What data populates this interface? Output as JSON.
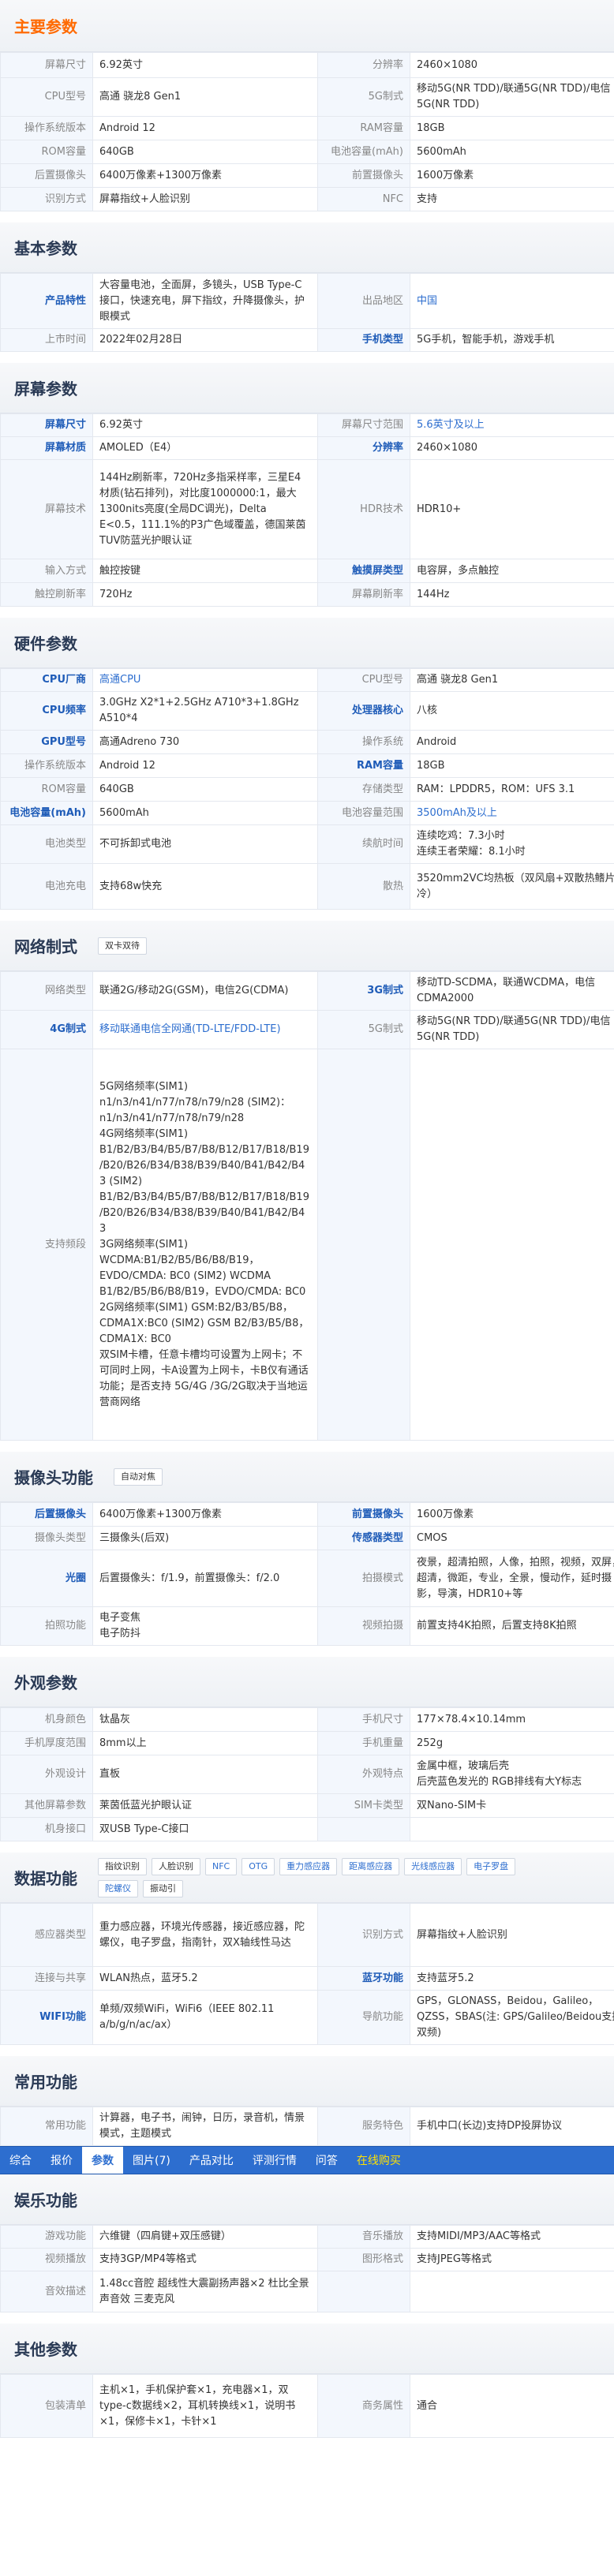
{
  "sections": {
    "main_params": {
      "title": "主要参数",
      "rows": [
        [
          "屏幕尺寸",
          "6.92英寸",
          "分辨率",
          "2460×1080"
        ],
        [
          "CPU型号",
          "高通 骁龙8 Gen1",
          "5G制式",
          "移动5G(NR TDD)/联通5G(NR TDD)/电信 5G(NR TDD)"
        ],
        [
          "操作系统版本",
          "Android 12",
          "RAM容量",
          "18GB"
        ],
        [
          "ROM容量",
          "640GB",
          "电池容量(mAh)",
          "5600mAh"
        ],
        [
          "后置摄像头",
          "6400万像素+1300万像素",
          "前置摄像头",
          "1600万像素"
        ],
        [
          "识别方式",
          "屏幕指纹+人脸识别",
          "NFC",
          "支持"
        ]
      ]
    },
    "basic": {
      "title": "基本参数",
      "rows": [
        [
          "产品特性",
          "大容量电池，全面屏，多镜头，USB Type-C接口，快速充电，屏下指纹，升降摄像头，护眼模式",
          "出品地区",
          "中国"
        ],
        [
          "上市时间",
          "2022年02月28日",
          "手机类型",
          "5G手机，智能手机，游戏手机"
        ]
      ]
    },
    "screen": {
      "title": "屏幕参数",
      "rows": [
        [
          "屏幕尺寸",
          "6.92英寸",
          "屏幕尺寸范围",
          "5.6英寸及以上"
        ],
        [
          "屏幕材质",
          "AMOLED（E4）",
          "分辨率",
          "2460×1080"
        ],
        [
          "屏幕技术",
          "144Hz刷新率，720Hz多指采样率，三星E4材质(钻石排列)，对比度1000000:1，最大1300nits亮度(全局DC调光)，Delta E<0.5，111.1%的P3广色域覆盖，德国莱茵TUV防蓝光护眼认证",
          "HDR技术",
          "HDR10+"
        ],
        [
          "输入方式",
          "触控按键",
          "触摸屏类型",
          "电容屏，多点触控"
        ],
        [
          "触控刷新率",
          "720Hz",
          "屏幕刷新率",
          "144Hz"
        ]
      ]
    },
    "hardware": {
      "title": "硬件参数",
      "rows": [
        [
          "CPU厂商",
          "高通CPU",
          "CPU型号",
          "高通 骁龙8 Gen1"
        ],
        [
          "CPU频率",
          "3.0GHz X2*1+2.5GHz A710*3+1.8GHz A510*4",
          "处理器核心",
          "八核"
        ],
        [
          "GPU型号",
          "高通Adreno 730",
          "操作系统",
          "Android"
        ],
        [
          "操作系统版本",
          "Android 12",
          "RAM容量",
          "18GB"
        ],
        [
          "ROM容量",
          "640GB",
          "存储类型",
          "RAM：LPDDR5，ROM：UFS 3.1"
        ],
        [
          "电池容量(mAh)",
          "5600mAh",
          "电池容量范围",
          "3500mAh及以上"
        ],
        [
          "电池类型",
          "不可拆卸式电池",
          "续航时间",
          "连续吃鸡：7.3小时\n连续王者荣耀：8.1小时"
        ],
        [
          "电池充电",
          "支持68w快充",
          "散热",
          "3520mm2VC均热板（双风扇+双散热鳍片液冷）"
        ]
      ]
    },
    "network": {
      "title": "网络制式",
      "tags": [
        "双卡双待"
      ],
      "rows": [
        [
          "网络类型",
          "联通2G/移动2G(GSM)，电信2G(CDMA)",
          "3G制式",
          "移动TD-SCDMA，联通WCDMA，电信CDMA2000"
        ],
        [
          "4G制式",
          "移动联通电信全网通(TD-LTE/FDD-LTE)",
          "5G制式",
          "移动5G(NR TDD)/联通5G(NR TDD)/电信 5G(NR TDD)"
        ],
        [
          "支持频段",
          "5G网络频率(SIM1) n1/n3/n41/n77/n78/n79/n28 (SIM2)：n1/n3/n41/n77/n78/n79/n28\n4G网络频率(SIM1) B1/B2/B3/B4/B5/B7/B8/B12/B17/B18/B19/B20/B26/B34/B38/B39/B40/B41/B42/B43 (SIM2) B1/B2/B3/B4/B5/B7/B8/B12/B17/B18/B19/B20/B26/B34/B38/B39/B40/B41/B42/B43\n3G网络频率(SIM1) WCDMA:B1/B2/B5/B6/B8/B19，EVDO/CMDA: BC0 (SIM2) WCDMA B1/B2/B5/B6/B8/B19，EVDO/CMDA: BC0\n2G网络频率(SIM1) GSM:B2/B3/B5/B8，CDMA1X:BC0 (SIM2) GSM B2/B3/B5/B8，CDMA1X: BC0\n双SIM卡槽，任意卡槽均可设置为上网卡；不可同时上网，卡A设置为上网卡，卡B仅有通话功能；是否支持 5G/4G /3G/2G取决于当地运营商网络",
          "",
          ""
        ]
      ]
    },
    "camera": {
      "title": "摄像头功能",
      "tags": [
        "自动对焦"
      ],
      "rows": [
        [
          "后置摄像头",
          "6400万像素+1300万像素",
          "前置摄像头",
          "1600万像素"
        ],
        [
          "摄像头类型",
          "三摄像头(后双)",
          "传感器类型",
          "CMOS"
        ],
        [
          "光圈",
          "后置摄像头：f/1.9，前置摄像头：f/2.0",
          "拍摄模式",
          "夜景，超清拍照，人像，拍照，视频，双屏，超清，微距，专业，全景，慢动作，延时摄影，导演，HDR10+等"
        ],
        [
          "拍照功能",
          "电子变焦\n电子防抖",
          "视频拍摄",
          "前置支持4K拍照，后置支持8K拍照"
        ]
      ]
    },
    "appearance": {
      "title": "外观参数",
      "rows": [
        [
          "机身颜色",
          "钛晶灰",
          "手机尺寸",
          "177×78.4×10.14mm"
        ],
        [
          "手机厚度范围",
          "8mm以上",
          "手机重量",
          "252g"
        ],
        [
          "外观设计",
          "直板",
          "外观特点",
          "金属中框，玻璃后壳\n后壳蓝色发光的 RGB排线有大Y标志"
        ],
        [
          "其他屏幕参数",
          "莱茵低蓝光护眼认证",
          "SIM卡类型",
          "双Nano-SIM卡"
        ],
        [
          "机身接口",
          "双USB Type-C接口",
          "",
          ""
        ]
      ]
    },
    "data": {
      "title": "数据功能",
      "tags": [
        "指纹识别",
        "人脸识别",
        "NFC",
        "OTG",
        "重力感应器",
        "距离感应器",
        "光线感应器",
        "电子罗盘",
        "陀螺仪",
        "振动引"
      ],
      "rows": [
        [
          "感应器类型",
          "重力感应器，环境光传感器，接近感应器，陀螺仪，电子罗盘，指南针，双X轴线性马达",
          "识别方式",
          "屏幕指纹+人脸识别"
        ],
        [
          "连接与共享",
          "WLAN热点，蓝牙5.2",
          "蓝牙功能",
          "支持蓝牙5.2"
        ],
        [
          "WIFI功能",
          "单频/双频WiFi，WiFi6（IEEE 802.11 a/b/g/n/ac/ax）",
          "导航功能",
          "GPS，GLONASS，Beidou，Galileo，QZSS，SBAS(注: GPS/Galileo/Beidou支持双频)"
        ]
      ]
    },
    "common": {
      "title": "常用功能",
      "rows": [
        [
          "常用功能",
          "计算器，电子书，闹钟，日历，录音机，情景模式，主题模式",
          "服务特色",
          "手机中口(长边)支持DP投屏协议"
        ]
      ]
    },
    "entertainment": {
      "title": "娱乐功能",
      "rows": [
        [
          "游戏功能",
          "六维键（四肩键+双压感键）",
          "音乐播放",
          "支持MIDI/MP3/AAC等格式"
        ],
        [
          "视频播放",
          "支持3GP/MP4等格式",
          "图形格式",
          "支持JPEG等格式"
        ],
        [
          "音效描述",
          "1.48cc音腔 超线性大震副扬声器×2 杜比全景声音效 三麦克风",
          "",
          ""
        ]
      ]
    },
    "other": {
      "title": "其他参数",
      "rows": [
        [
          "包装清单",
          "主机×1，手机保护套×1，充电器×1，双type-c数据线×2，耳机转换线×1，说明书×1，保修卡×1，卡针×1",
          "商务属性",
          "通合"
        ]
      ]
    }
  },
  "navbar": {
    "items": [
      "综合",
      "报价",
      "参数",
      "图片(7)",
      "产品对比",
      "评测行情",
      "问答",
      "在线购买"
    ],
    "active_index": 2
  },
  "colors": {
    "key_bg": "#f3f7fd",
    "key_bold": "#1f5cb8",
    "link": "#2d6ecf",
    "orange_title": "#ff6a00",
    "nav_bg": "#2d6ecf",
    "nav_buy": "#ffe100"
  }
}
